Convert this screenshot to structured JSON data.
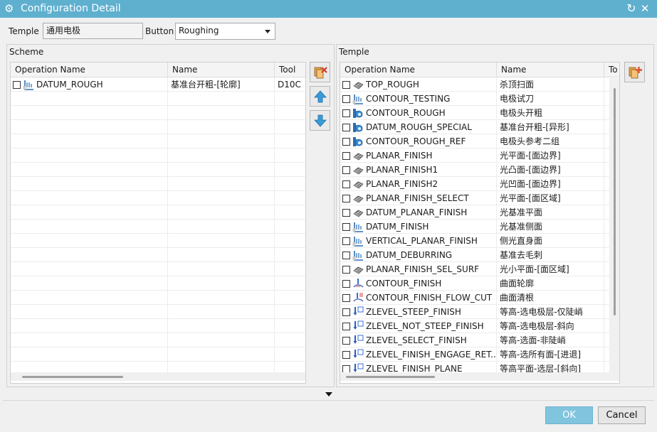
{
  "window": {
    "title": "Configuration Detail"
  },
  "form": {
    "temple_label": "Temple",
    "temple_value": "通用电极",
    "button_label": "Button",
    "button_value": "Roughing"
  },
  "scheme": {
    "label": "Scheme",
    "columns": [
      "Operation Name",
      "Name",
      "Tool"
    ],
    "rows": [
      {
        "op": "DATUM_ROUGH",
        "name": "基准台开粗-[轮廓]",
        "tool": "D10C",
        "icon": "wall-icon"
      }
    ]
  },
  "temple_list": {
    "label": "Temple",
    "columns": [
      "Operation Name",
      "Name",
      "To"
    ],
    "rows": [
      {
        "op": "TOP_ROUGH",
        "name": "杀顶扫面",
        "icon": "surface-icon"
      },
      {
        "op": "CONTOUR_TESTING",
        "name": "电极试刀",
        "icon": "wall-icon"
      },
      {
        "op": "CONTOUR_ROUGH",
        "name": "电极头开粗",
        "icon": "cavity-icon"
      },
      {
        "op": "DATUM_ROUGH_SPECIAL",
        "name": "基准台开粗-[异形]",
        "icon": "cavity-icon"
      },
      {
        "op": "CONTOUR_ROUGH_REF",
        "name": "电极头参考二组",
        "icon": "cavity-icon"
      },
      {
        "op": "PLANAR_FINISH",
        "name": "光平面-[面边界]",
        "icon": "surface-icon"
      },
      {
        "op": "PLANAR_FINISH1",
        "name": "光凸面-[面边界]",
        "icon": "surface-icon"
      },
      {
        "op": "PLANAR_FINISH2",
        "name": "光凹面-[面边界]",
        "icon": "surface-icon"
      },
      {
        "op": "PLANAR_FINISH_SELECT",
        "name": "光平面-[面区域]",
        "icon": "surface-icon"
      },
      {
        "op": "DATUM_PLANAR_FINISH",
        "name": "光基准平面",
        "icon": "surface-icon"
      },
      {
        "op": "DATUM_FINISH",
        "name": "光基准侧面",
        "icon": "wall-icon"
      },
      {
        "op": "VERTICAL_PLANAR_FINISH",
        "name": "侧光直身面",
        "icon": "wall-icon"
      },
      {
        "op": "DATUM_DEBURRING",
        "name": "基准去毛刺",
        "icon": "wall-icon"
      },
      {
        "op": "PLANAR_FINISH_SEL_SURF",
        "name": "光小平面-[面区域]",
        "icon": "surface-icon"
      },
      {
        "op": "CONTOUR_FINISH",
        "name": "曲面轮廓",
        "icon": "contour-icon"
      },
      {
        "op": "CONTOUR_FINISH_FLOW_CUT",
        "name": "曲面清根",
        "icon": "flowcut-icon"
      },
      {
        "op": "ZLEVEL_STEEP_FINISH",
        "name": "等高-选电极层-仅陡峭",
        "icon": "zlevel-icon"
      },
      {
        "op": "ZLEVEL_NOT_STEEP_FINISH",
        "name": "等高-选电极层-斜向",
        "icon": "zlevel-icon"
      },
      {
        "op": "ZLEVEL_SELECT_FINISH",
        "name": "等高-选面-非陡峭",
        "icon": "zlevel-icon"
      },
      {
        "op": "ZLEVEL_FINISH_ENGAGE_RET...",
        "name": "等高-选所有面-[进退]",
        "icon": "zlevel-icon"
      },
      {
        "op": "ZLEVEL_FINISH_PLANE",
        "name": "等高平面-选层-[斜向]",
        "icon": "zlevel-icon"
      }
    ]
  },
  "buttons": {
    "ok": "OK",
    "cancel": "Cancel"
  },
  "colors": {
    "titlebar": "#5fb0cf",
    "ok_button": "#80c4de"
  }
}
